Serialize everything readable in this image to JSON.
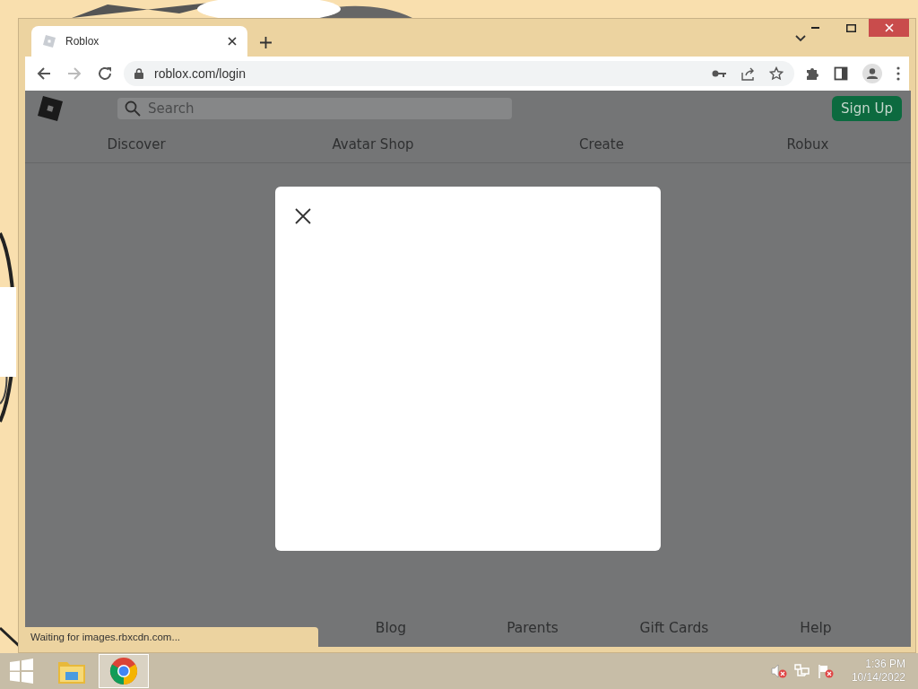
{
  "browser": {
    "tabs": [
      {
        "title": "Roblox",
        "selected": true
      }
    ],
    "address": "roblox.com/login"
  },
  "site": {
    "search": {
      "placeholder": "Search"
    },
    "signup": "Sign Up",
    "nav": [
      "Discover",
      "Avatar Shop",
      "Create",
      "Robux"
    ],
    "footer_links": [
      "Blog",
      "Parents",
      "Gift Cards",
      "Help"
    ]
  },
  "status_text": "Waiting for images.rbxcdn.com...",
  "taskbar": {
    "apps": [
      {
        "kind": "folder",
        "selected": false
      },
      {
        "kind": "chrome",
        "selected": true
      }
    ],
    "clock": {
      "time": "1:36 PM",
      "date": "10/14/2022"
    }
  }
}
